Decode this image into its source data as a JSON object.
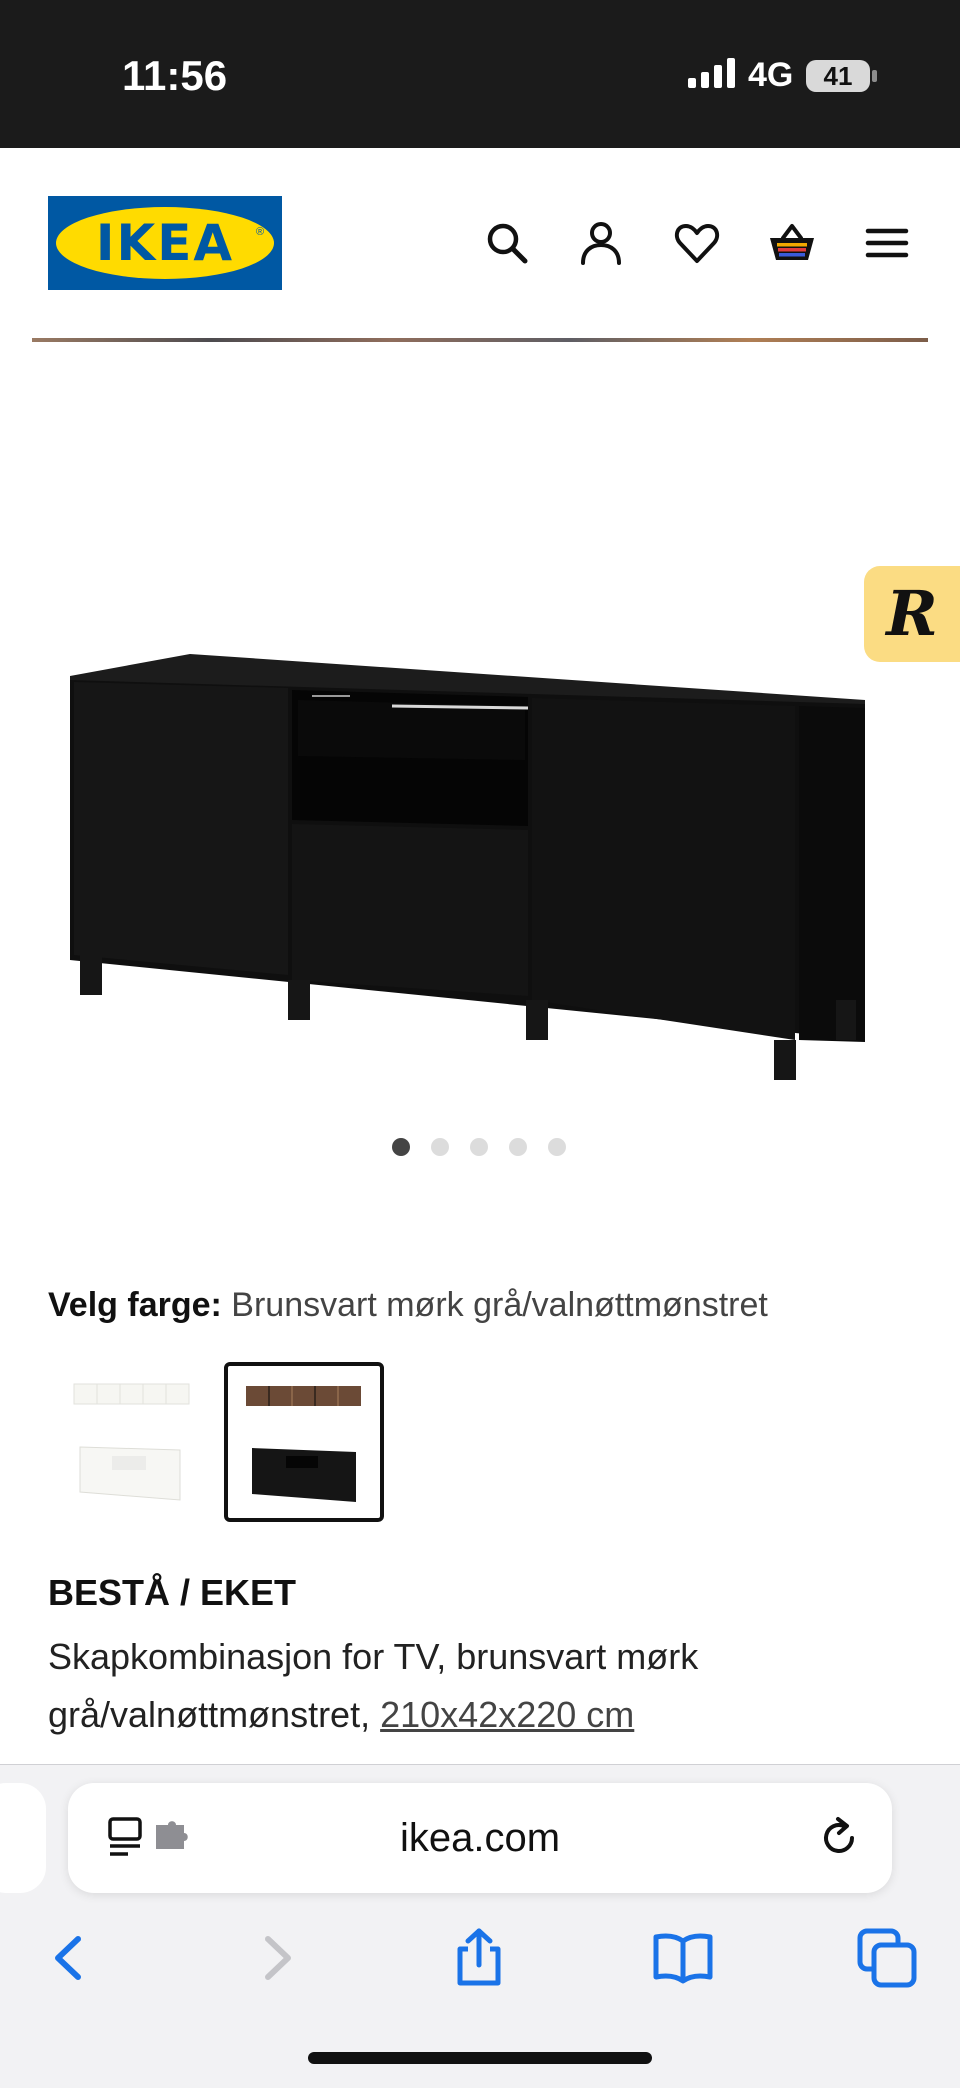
{
  "status_bar": {
    "time": "11:56",
    "network": "4G",
    "battery": "41"
  },
  "header": {
    "logo_text": "IKEA",
    "icons": [
      "search-icon",
      "account-icon",
      "heart-icon",
      "cart-icon",
      "menu-icon"
    ]
  },
  "floating_badge": {
    "letter": "R"
  },
  "gallery": {
    "image_count": 5,
    "active_index": 0
  },
  "color_selector": {
    "label": "Velg farge:",
    "selected_value": "Brunsvart mørk grå/valnøttmønstret",
    "options": [
      {
        "name": "white-option",
        "selected": false
      },
      {
        "name": "black-brown-walnut-option",
        "selected": true
      }
    ]
  },
  "product": {
    "name": "BESTÅ / EKET",
    "description": "Skapkombinasjon for TV, brunsvart mørk grå/valnøttmønstret,",
    "dimensions": "210x42x220 cm"
  },
  "browser": {
    "url": "ikea.com",
    "toolbar_icons": [
      "back-icon",
      "forward-icon",
      "share-icon",
      "bookmarks-icon",
      "tabs-icon"
    ]
  },
  "colors": {
    "ikea_blue": "#0058a3",
    "ikea_yellow": "#ffdb00",
    "ios_blue": "#1a73e8"
  }
}
